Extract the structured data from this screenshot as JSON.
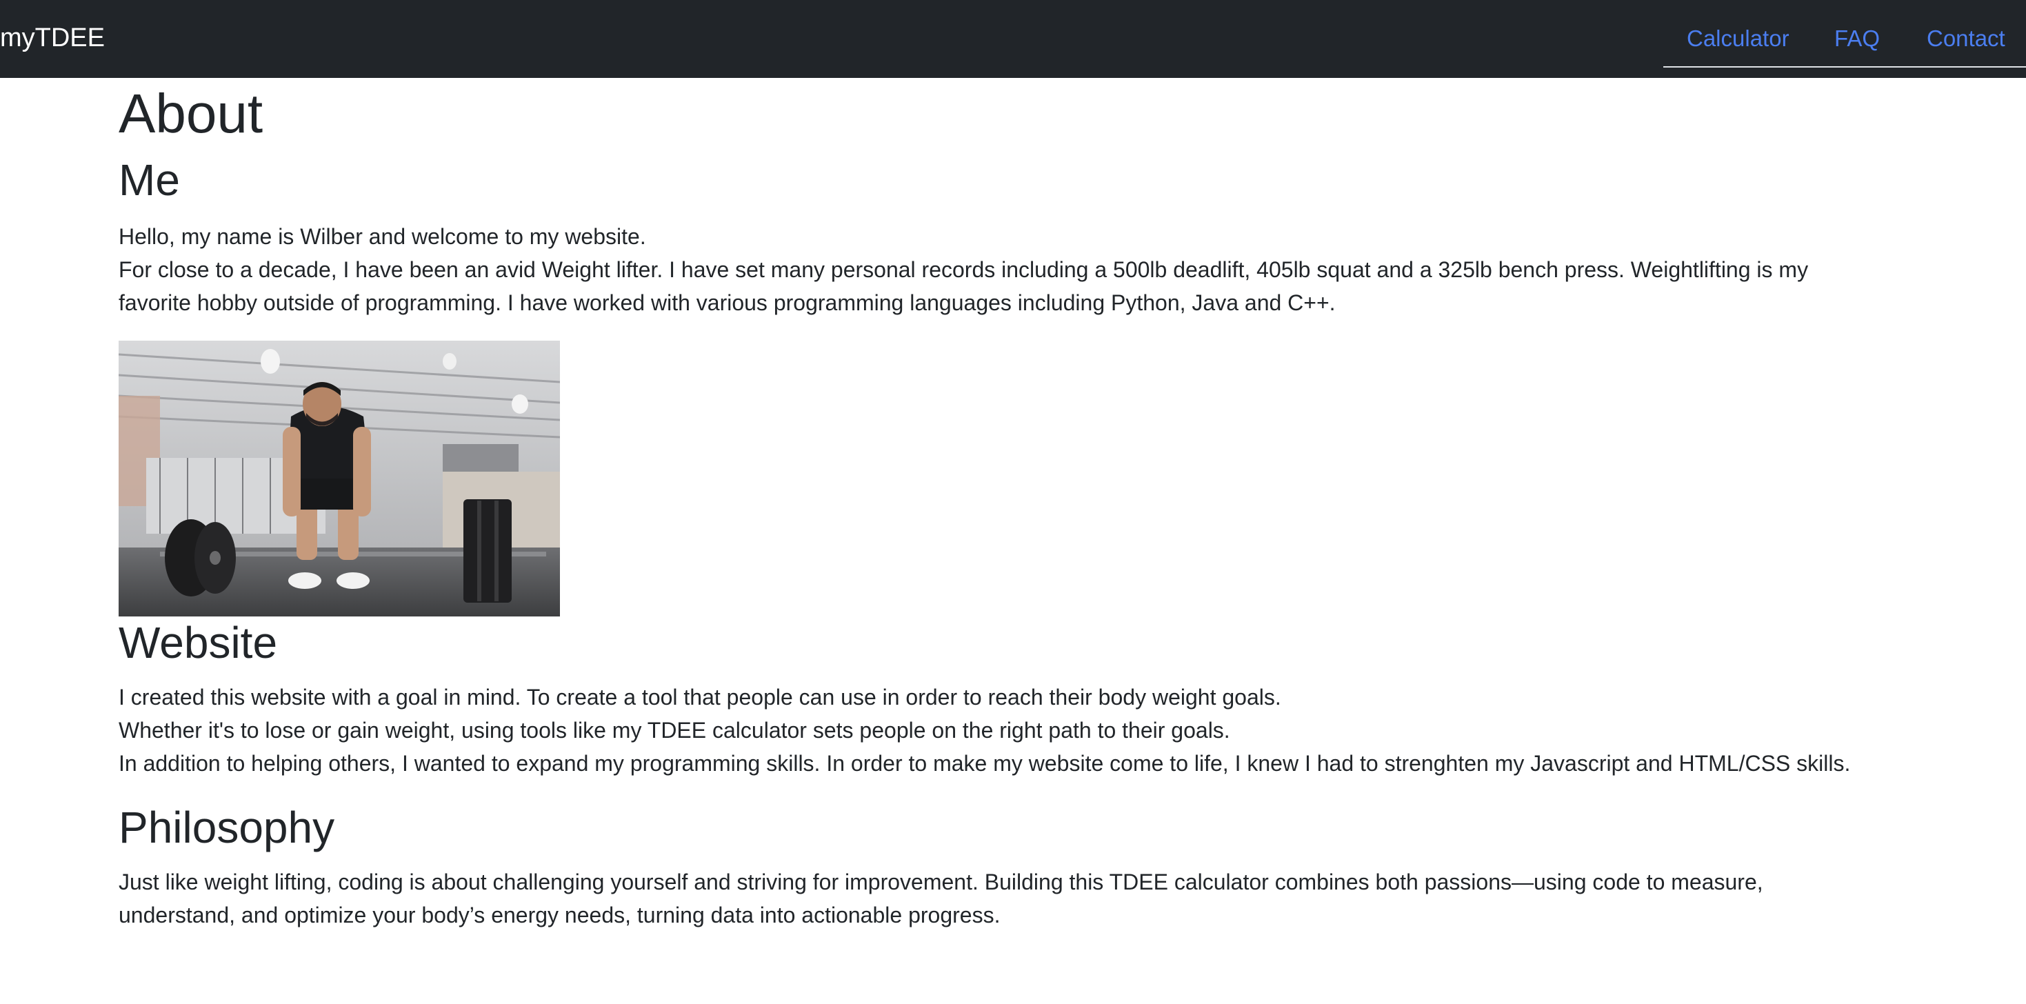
{
  "nav": {
    "brand": "myTDEE",
    "links": [
      "Calculator",
      "FAQ",
      "Contact"
    ]
  },
  "page": {
    "title": "About"
  },
  "me": {
    "heading": "Me",
    "greeting": "Hello, my name is Wilber and welcome to my website.",
    "bio_line1": "For close to a decade, I have been an avid Weight lifter. I have set many personal records including a 500lb deadlift, 405lb squat and a 325lb bench press. Weightlifting is my",
    "bio_line2": "favorite hobby outside of programming. I have worked with various programming languages including Python, Java and C++."
  },
  "website": {
    "heading": "Website",
    "line1": "I created this website with a goal in mind. To create a tool that people can use in order to reach their body weight goals.",
    "line2": "Whether it's to lose or gain weight, using tools like my TDEE calculator sets people on the right path to their goals.",
    "line3": "In addition to helping others, I wanted to expand my programming skills. In order to make my website come to life, I knew I had to strenghten my Javascript and HTML/CSS skills."
  },
  "philosophy": {
    "heading": "Philosophy",
    "line1": "Just like weight lifting, coding is about challenging yourself and striving for improvement. Building this TDEE calculator combines both passions—using code to measure,",
    "line2": "understand, and optimize your body’s energy needs, turning data into actionable progress."
  },
  "colors": {
    "navbar_bg": "#212529",
    "link": "#4b7ef0",
    "text": "#212529"
  }
}
